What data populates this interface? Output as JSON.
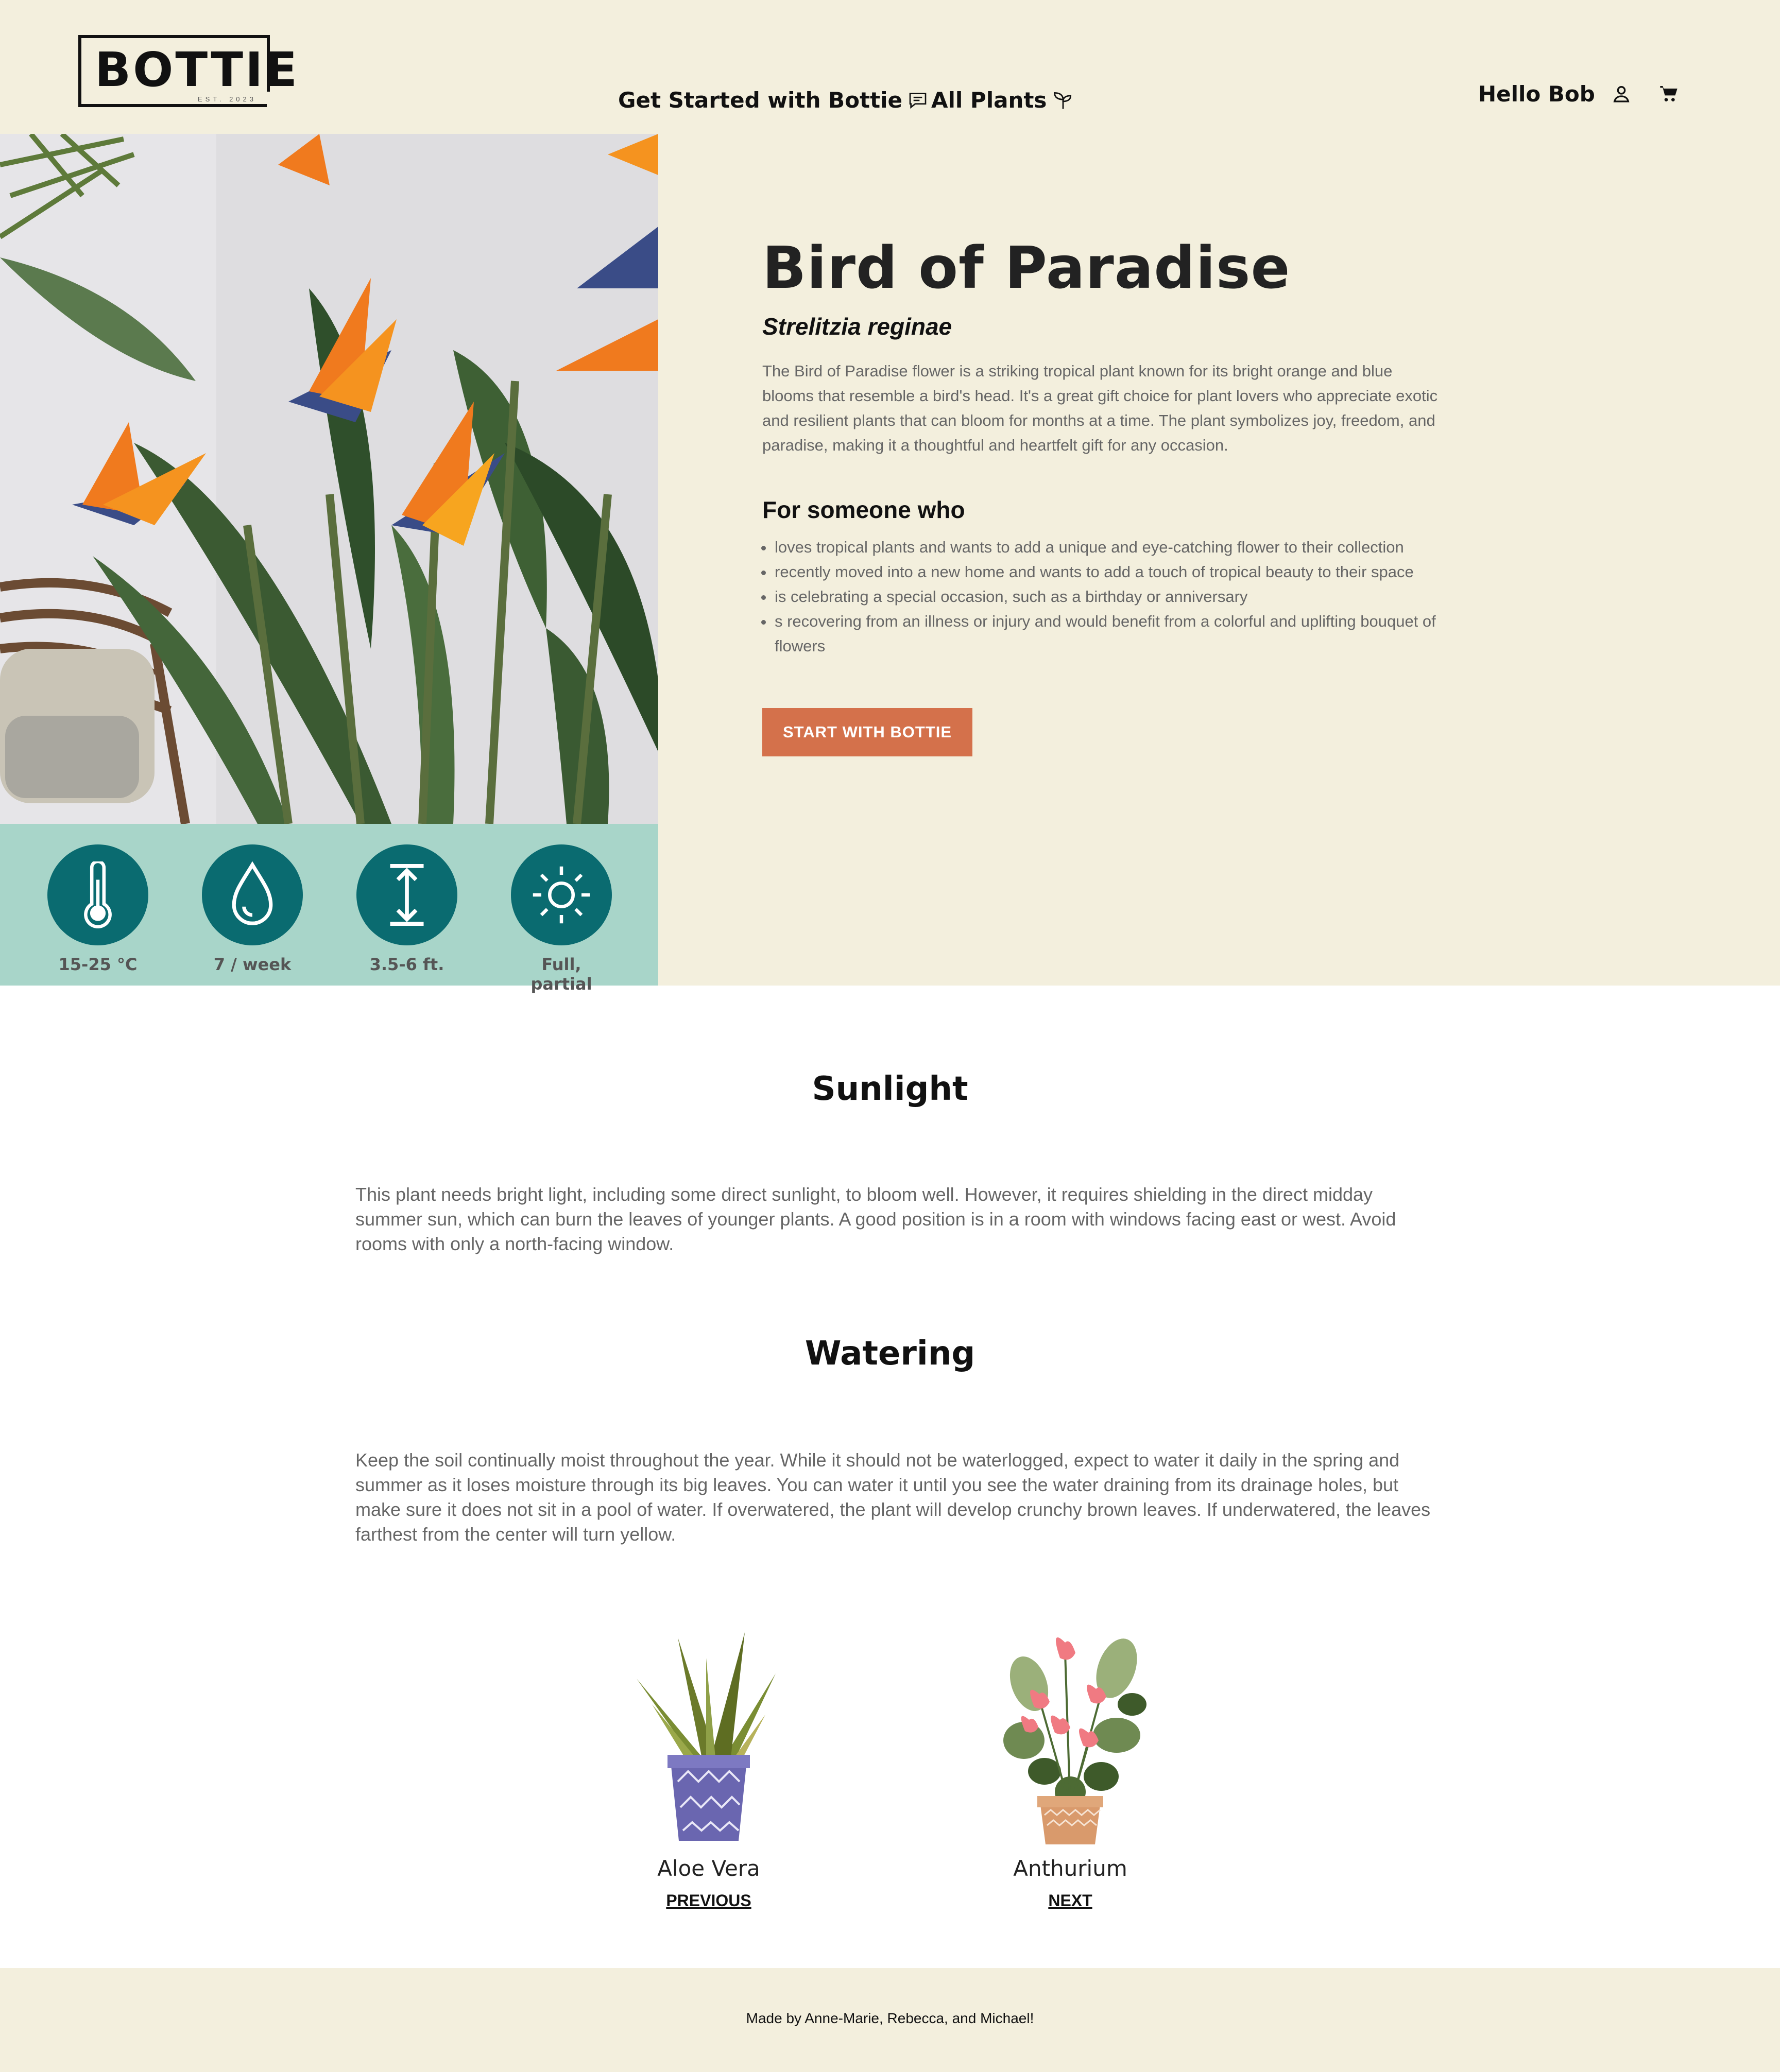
{
  "header": {
    "logo_text": "BOTTIE",
    "logo_sub": "EST. 2023",
    "nav": {
      "get_started": "Get Started with Bottie",
      "all_plants": "All Plants"
    },
    "greeting": "Hello Bob",
    "icons": [
      "chat-icon",
      "sprout-icon",
      "user-icon",
      "cart-icon"
    ]
  },
  "product": {
    "name": "Bird of Paradise",
    "scientific_name": "Strelitzia reginae",
    "description": "The Bird of Paradise flower is a striking tropical plant known for its bright orange and blue blooms that resemble a bird's head. It's a great gift choice for plant lovers who appreciate exotic and resilient plants that can bloom for months at a time. The plant symbolizes joy, freedom, and paradise, making it a thoughtful and heartfelt gift for any occasion.",
    "for_heading": "For someone who",
    "for_items": [
      "loves tropical plants and wants to add a unique and eye-catching flower to their collection",
      "recently moved into a new home and wants to add a touch of tropical beauty to their space",
      "is celebrating a special occasion, such as a birthday or anniversary",
      "s recovering from an illness or injury and would benefit from a colorful and uplifting bouquet of flowers"
    ],
    "cta_label": "START WITH BOTTIE"
  },
  "stats": {
    "temperature": "15-25 °C",
    "water": "7 / week",
    "height": "3.5-6 ft.",
    "light": "Full, partial"
  },
  "care": {
    "sunlight_title": "Sunlight",
    "sunlight_text": "This plant needs bright light, including some direct sunlight, to bloom well. However, it requires shielding in the direct midday summer sun, which can burn the leaves of younger plants. A good position is in a room with windows facing east or west. Avoid rooms with only a north-facing window.",
    "watering_title": "Watering",
    "watering_text": "Keep the soil continually moist throughout the year. While it should not be waterlogged, expect to water it daily in the spring and summer as it loses moisture through its big leaves. You can water it until you see the water draining from its drainage holes, but make sure it does not sit in a pool of water. If overwatered, the plant will develop crunchy brown leaves. If underwatered, the leaves farthest from the center will turn yellow."
  },
  "pager": {
    "prev_name": "Aloe Vera",
    "prev_label": "PREVIOUS",
    "next_name": "Anthurium",
    "next_label": "NEXT"
  },
  "footer": {
    "credit": "Made by Anne-Marie, Rebecca, and Michael!"
  },
  "colors": {
    "cream": "#f3efdd",
    "accent": "#d4714b",
    "teal": "#0a6b70",
    "mint": "#a8d5c9"
  }
}
